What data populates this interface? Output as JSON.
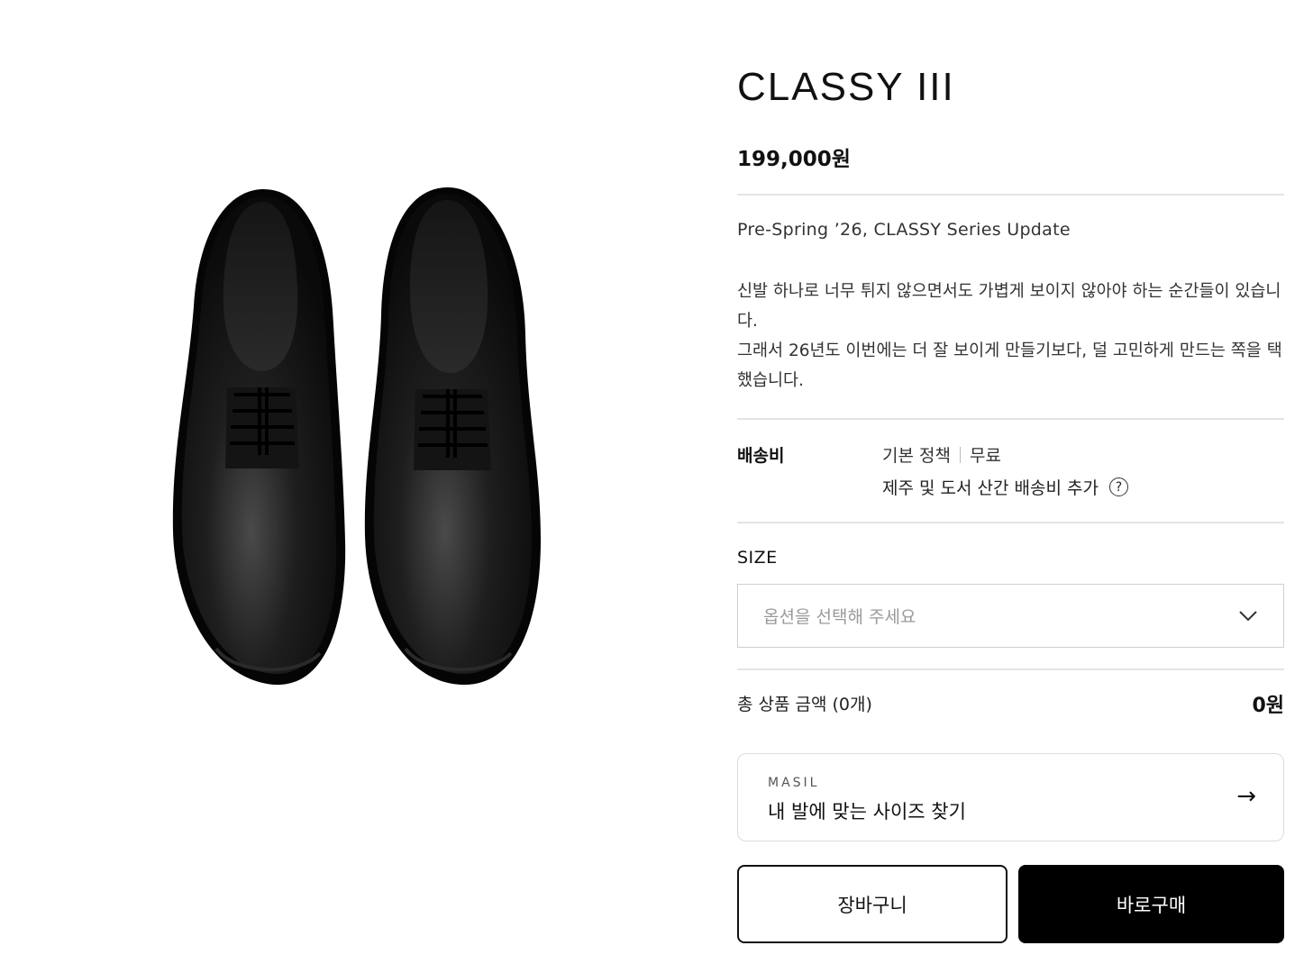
{
  "product": {
    "title": "CLASSY III",
    "price": "199,000원",
    "subtitle": "Pre-Spring ’26, CLASSY Series Update",
    "description": [
      "신발 하나로 너무 튀지 않으면서도 가볍게 보이지 않아야 하는 순간들이 있습니다.",
      "그래서 26년도 이번에는 더 잘 보이게 만들기보다, 덜 고민하게 만드는 쪽을 택했습니다."
    ]
  },
  "shipping": {
    "label": "배송비",
    "policy": "기본 정책",
    "fee": "무료",
    "extra": "제주 및 도서 산간 배송비 추가",
    "help_icon": "question-circle-icon"
  },
  "size": {
    "label": "SIZE",
    "placeholder": "옵션을 선택해 주세요",
    "chevron_icon": "chevron-down-icon"
  },
  "total": {
    "label": "총 상품 금액 (0개)",
    "value": "0원"
  },
  "size_finder": {
    "brand": "MASIL",
    "cta": "내 발에 맞는 사이즈 찾기",
    "arrow_icon": "arrow-right-icon"
  },
  "actions": {
    "cart": "장바구니",
    "buy": "바로구매"
  },
  "colors": {
    "primary": "#000000",
    "divider": "#e4e4e4",
    "placeholder": "#999999"
  }
}
